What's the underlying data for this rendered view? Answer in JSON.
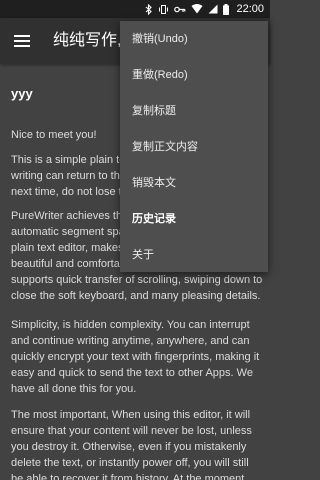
{
  "status": {
    "time": "22:00"
  },
  "appbar": {
    "title": "纯纯写作,匠心独运"
  },
  "doc": {
    "title": "yyy",
    "paragraphs": [
      "Nice to meet you!",
      "This is a simple plain text editor. The text you are writing can return to this point, the text you write next time, do not lose the content.",
      "PureWriter achieves the automatic indent, automatic segment spacing on the basis of the plain text editor, makes your text look more beautiful and comfortable. At the same time, it also supports quick transfer of scrolling, swiping down to close the soft keyboard, and many pleasing details.",
      "Simplicity, is hidden complexity. You can interrupt and continue writing anytime, anywhere, and can quickly encrypt your text with fingerprints, making it easy and quick to send the text to other Apps. We have all done this for you.",
      "The most important, When using this editor, it will ensure that your content will never be lost, unless you destroy it. Otherwise, even if you mistakenly delete the text, or instantly power off, you will still be able to recover it from history. At the moment"
    ]
  },
  "menu": {
    "items": [
      {
        "label": "撤销(Undo)"
      },
      {
        "label": "重做(Redo)"
      },
      {
        "label": "复制标题"
      },
      {
        "label": "复制正文内容"
      },
      {
        "label": "销毁本文"
      },
      {
        "label": "历史记录"
      },
      {
        "label": "关于"
      }
    ]
  }
}
